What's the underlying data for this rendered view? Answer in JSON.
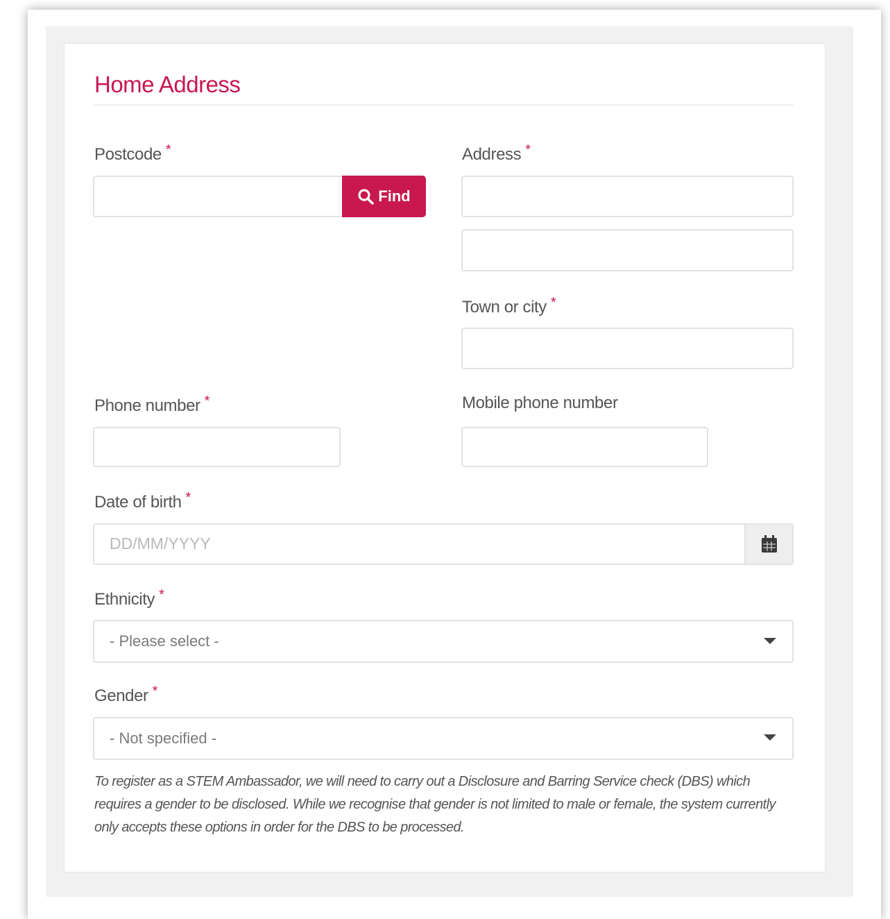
{
  "section": {
    "title": "Home Address"
  },
  "required_marker": "*",
  "postcode": {
    "label": "Postcode",
    "value": "",
    "find_button": "Find"
  },
  "address": {
    "label": "Address",
    "line1": "",
    "line2": ""
  },
  "town": {
    "label": "Town or city",
    "value": ""
  },
  "phone": {
    "label": "Phone number",
    "value": ""
  },
  "mobile": {
    "label": "Mobile phone number",
    "value": ""
  },
  "dob": {
    "label": "Date of birth",
    "placeholder": "DD/MM/YYYY",
    "icon": "calendar-icon"
  },
  "ethnicity": {
    "label": "Ethnicity",
    "selected": "- Please select -"
  },
  "gender": {
    "label": "Gender",
    "selected": "- Not specified -"
  },
  "gender_note": "To register as a STEM Ambassador, we will need to carry out a Disclosure and Barring Service check (DBS) which requires a gender to be disclosed. While we recognise that gender is not limited to male or female, the system currently only accepts these options in order for the DBS to be processed.",
  "colors": {
    "accent": "#c9174f",
    "label": "#555555",
    "border": "#e2e2e2"
  }
}
